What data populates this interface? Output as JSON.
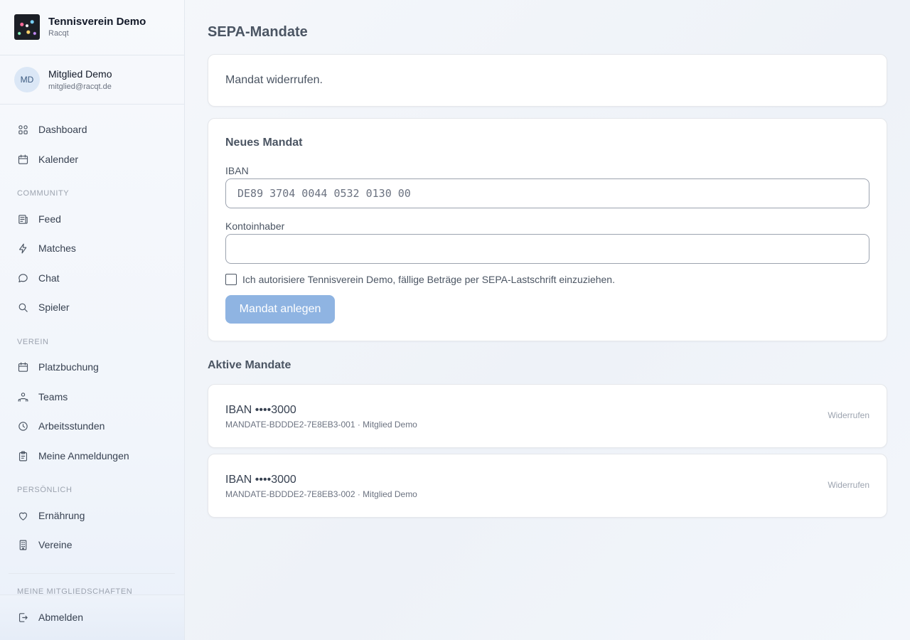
{
  "sidebar": {
    "brand": {
      "name": "Tennisverein Demo",
      "sub": "Racqt"
    },
    "user": {
      "initials": "MD",
      "name": "Mitglied Demo",
      "email": "mitglied@racqt.de"
    },
    "items": [
      {
        "label": "Dashboard",
        "icon": "dashboard-icon"
      },
      {
        "label": "Kalender",
        "icon": "calendar-icon"
      },
      {
        "label": "Feed",
        "icon": "feed-icon"
      },
      {
        "label": "Matches",
        "icon": "lightning-icon"
      },
      {
        "label": "Chat",
        "icon": "chat-icon"
      },
      {
        "label": "Spieler",
        "icon": "search-icon"
      },
      {
        "label": "Platzbuchung",
        "icon": "calendar-icon"
      },
      {
        "label": "Teams",
        "icon": "teams-icon"
      },
      {
        "label": "Arbeitsstunden",
        "icon": "clock-icon"
      },
      {
        "label": "Meine Anmeldungen",
        "icon": "clipboard-icon"
      },
      {
        "label": "Ernährung",
        "icon": "heart-icon"
      },
      {
        "label": "Vereine",
        "icon": "building-icon"
      }
    ],
    "sections": {
      "community": "COMMUNITY",
      "verein": "VEREIN",
      "persoenlich": "PERSÖNLICH",
      "memberships": "MEINE MITGLIEDSCHAFTEN"
    },
    "logout": {
      "label": "Abmelden",
      "icon": "logout-icon"
    }
  },
  "page": {
    "title": "SEPA-Mandate",
    "notice": "Mandat widerrufen.",
    "form": {
      "title": "Neues Mandat",
      "iban_label": "IBAN",
      "iban_placeholder": "DE89 3704 0044 0532 0130 00",
      "holder_label": "Kontoinhaber",
      "holder_value": "",
      "consent_text": "Ich autorisiere Tennisverein Demo, fällige Beträge per SEPA-Lastschrift einzuziehen.",
      "consent_checked": false,
      "submit_label": "Mandat anlegen"
    },
    "active": {
      "title": "Aktive Mandate",
      "mandates": [
        {
          "iban": "IBAN ••••3000",
          "meta": "MANDATE-BDDDE2-7E8EB3-001 · Mitglied Demo",
          "action": "Widerrufen"
        },
        {
          "iban": "IBAN ••••3000",
          "meta": "MANDATE-BDDDE2-7E8EB3-002 · Mitglied Demo",
          "action": "Widerrufen"
        }
      ]
    }
  }
}
